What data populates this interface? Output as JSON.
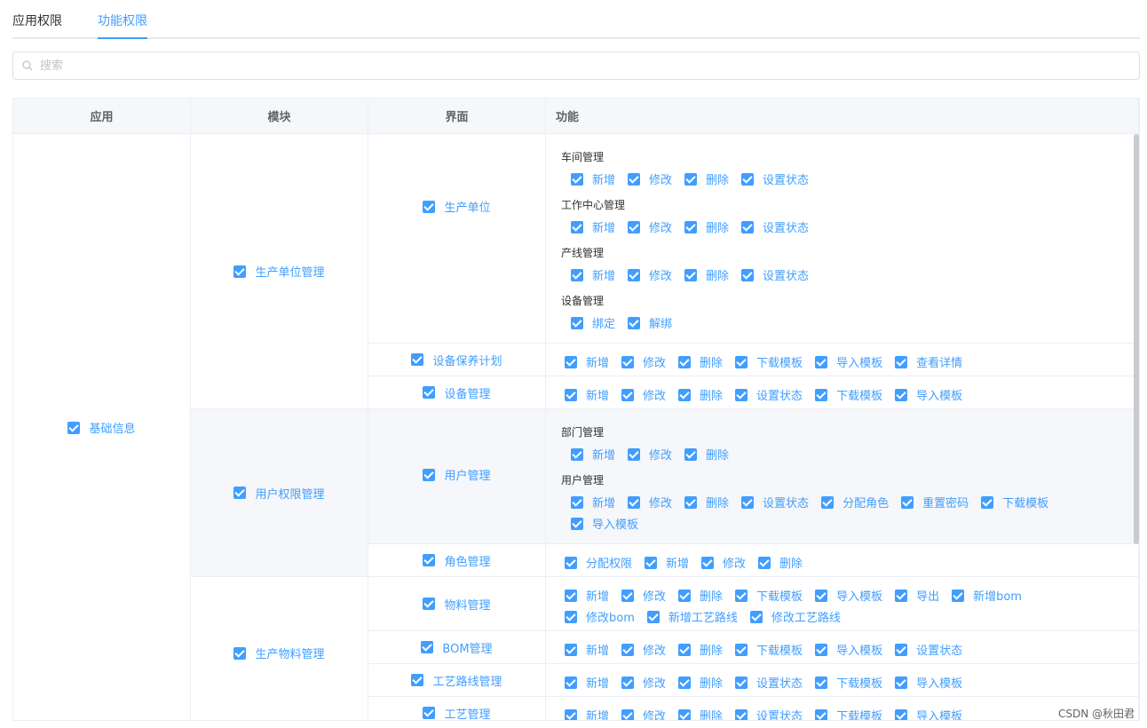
{
  "tabs": [
    {
      "label": "应用权限",
      "active": false
    },
    {
      "label": "功能权限",
      "active": true
    }
  ],
  "search": {
    "placeholder": "搜索",
    "value": ""
  },
  "table": {
    "headers": [
      "应用",
      "模块",
      "界面",
      "功能"
    ],
    "app": {
      "label": "基础信息",
      "checked": true
    },
    "modules": [
      {
        "label": "生产单位管理",
        "checked": true
      },
      {
        "label": "用户权限管理",
        "checked": true
      },
      {
        "label": "生产物料管理",
        "checked": true
      }
    ],
    "pages": [
      {
        "label": "生产单位",
        "checked": true
      },
      {
        "label": "设备保养计划",
        "checked": true
      },
      {
        "label": "设备管理",
        "checked": true
      },
      {
        "label": "用户管理",
        "checked": true
      },
      {
        "label": "角色管理",
        "checked": true
      },
      {
        "label": "物料管理",
        "checked": true
      },
      {
        "label": "BOM管理",
        "checked": true
      },
      {
        "label": "工艺路线管理",
        "checked": true
      },
      {
        "label": "工艺管理",
        "checked": true
      }
    ],
    "functions": {
      "unit": [
        {
          "title": "车间管理",
          "items": [
            "新增",
            "修改",
            "删除",
            "设置状态"
          ]
        },
        {
          "title": "工作中心管理",
          "items": [
            "新增",
            "修改",
            "删除",
            "设置状态"
          ]
        },
        {
          "title": "产线管理",
          "items": [
            "新增",
            "修改",
            "删除",
            "设置状态"
          ]
        },
        {
          "title": "设备管理",
          "items": [
            "绑定",
            "解绑"
          ]
        }
      ],
      "maint": [
        "新增",
        "修改",
        "删除",
        "下载模板",
        "导入模板",
        "查看详情"
      ],
      "device": [
        "新增",
        "修改",
        "删除",
        "设置状态",
        "下载模板",
        "导入模板"
      ],
      "user": [
        {
          "title": "部门管理",
          "items": [
            "新增",
            "修改",
            "删除"
          ]
        },
        {
          "title": "用户管理",
          "items": [
            "新增",
            "修改",
            "删除",
            "设置状态",
            "分配角色",
            "重置密码",
            "下载模板"
          ],
          "items2": [
            "导入模板"
          ]
        }
      ],
      "role": [
        "分配权限",
        "新增",
        "修改",
        "删除"
      ],
      "material": [
        "新增",
        "修改",
        "删除",
        "下载模板",
        "导入模板",
        "导出",
        "新增bom"
      ],
      "material2": [
        "修改bom",
        "新增工艺路线",
        "修改工艺路线"
      ],
      "bom": [
        "新增",
        "修改",
        "删除",
        "下载模板",
        "导入模板",
        "设置状态"
      ],
      "route": [
        "新增",
        "修改",
        "删除",
        "设置状态",
        "下载模板",
        "导入模板"
      ],
      "craft": [
        "新增",
        "修改",
        "删除",
        "设置状态",
        "下载模板",
        "导入模板"
      ]
    }
  },
  "watermark": "CSDN @秋田君",
  "colors": {
    "accent": "#409eff",
    "header_bg": "#f5f7fa",
    "border": "#ebeef5"
  }
}
